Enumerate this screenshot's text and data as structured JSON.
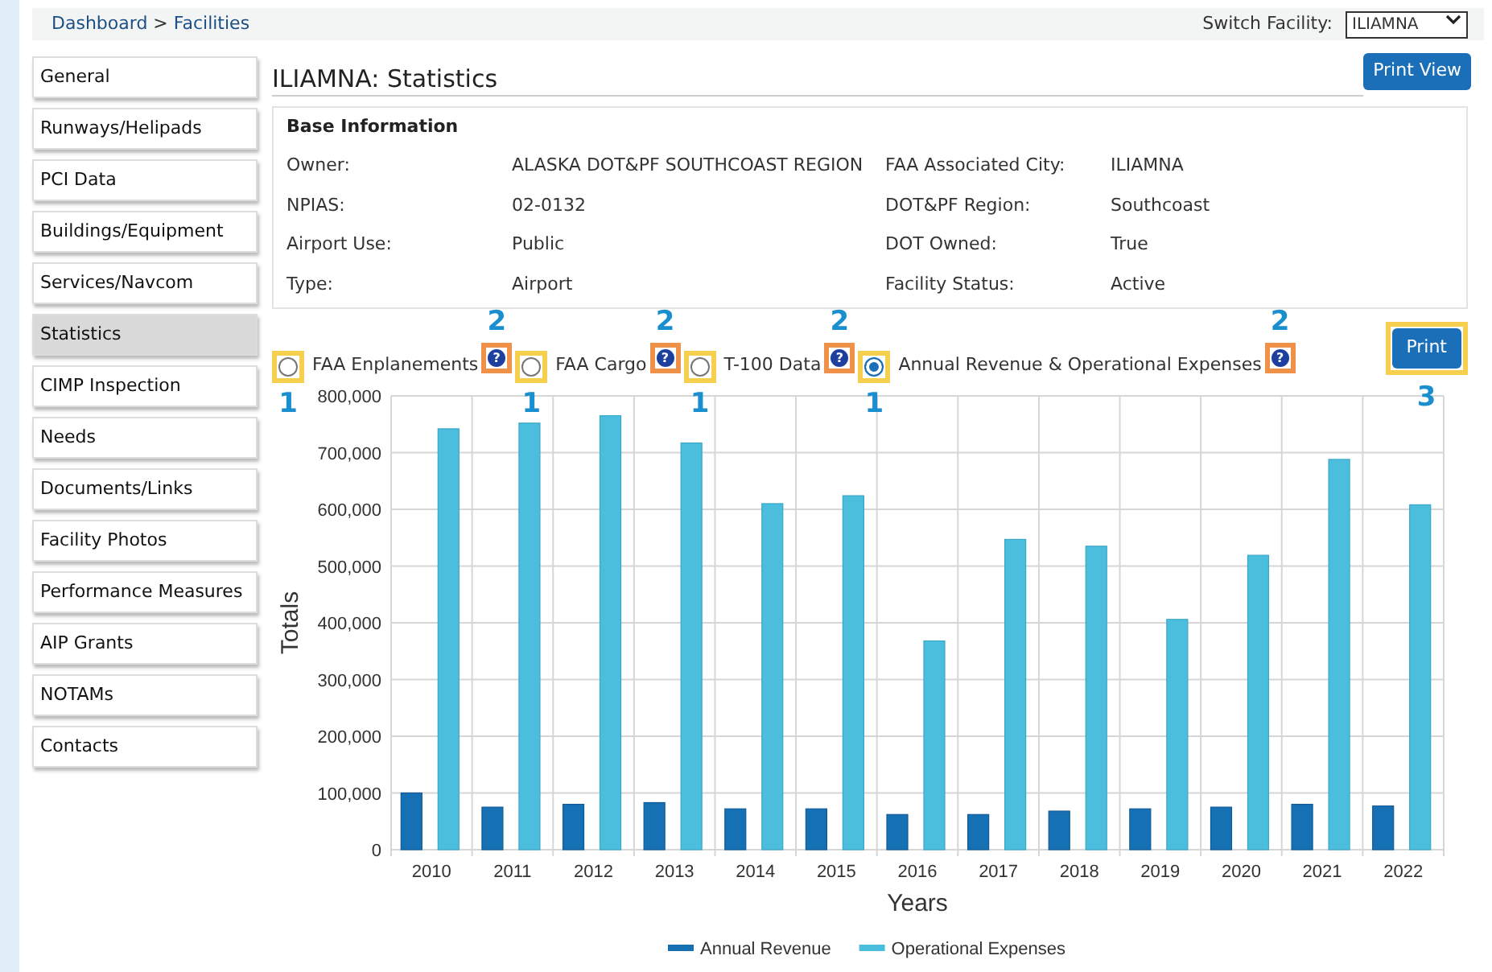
{
  "breadcrumb": {
    "items": [
      "Dashboard",
      "Facilities"
    ],
    "separator": ">"
  },
  "switch_facility": {
    "label": "Switch Facility:",
    "value": "ILIAMNA"
  },
  "sidebar": {
    "items": [
      {
        "label": "General",
        "selected": false
      },
      {
        "label": "Runways/Helipads",
        "selected": false
      },
      {
        "label": "PCI Data",
        "selected": false
      },
      {
        "label": "Buildings/Equipment",
        "selected": false
      },
      {
        "label": "Services/Navcom",
        "selected": false
      },
      {
        "label": "Statistics",
        "selected": true
      },
      {
        "label": "CIMP Inspection",
        "selected": false
      },
      {
        "label": "Needs",
        "selected": false
      },
      {
        "label": "Documents/Links",
        "selected": false
      },
      {
        "label": "Facility Photos",
        "selected": false
      },
      {
        "label": "Performance Measures",
        "selected": false
      },
      {
        "label": "AIP Grants",
        "selected": false
      },
      {
        "label": "NOTAMs",
        "selected": false
      },
      {
        "label": "Contacts",
        "selected": false
      }
    ]
  },
  "page_title": "ILIAMNA: Statistics",
  "print_view_button": "Print View",
  "base_information": {
    "title": "Base Information",
    "fields": [
      {
        "label": "Owner:",
        "value": "ALASKA DOT&PF SOUTHCOAST REGION"
      },
      {
        "label": "FAA Associated City:",
        "value": "ILIAMNA"
      },
      {
        "label": "NPIAS:",
        "value": "02-0132"
      },
      {
        "label": "DOT&PF Region:",
        "value": "Southcoast"
      },
      {
        "label": "Airport Use:",
        "value": "Public"
      },
      {
        "label": "DOT Owned:",
        "value": "True"
      },
      {
        "label": "Type:",
        "value": "Airport"
      },
      {
        "label": "Facility Status:",
        "value": "Active"
      }
    ]
  },
  "data_options": [
    {
      "label": "FAA Enplanements",
      "selected": false,
      "help_icon": "?",
      "radio_callout": "1",
      "help_callout": "2"
    },
    {
      "label": "FAA Cargo",
      "selected": false,
      "help_icon": "?",
      "radio_callout": "1",
      "help_callout": "2"
    },
    {
      "label": "T-100 Data",
      "selected": false,
      "help_icon": "?",
      "radio_callout": "1",
      "help_callout": "2"
    },
    {
      "label": "Annual Revenue & Operational Expenses",
      "selected": true,
      "help_icon": "?",
      "radio_callout": "1",
      "help_callout": "2"
    }
  ],
  "print_button": {
    "label": "Print",
    "callout": "3"
  },
  "chart_data": {
    "type": "bar",
    "xlabel": "Years",
    "ylabel": "Totals",
    "categories": [
      "2010",
      "2011",
      "2012",
      "2013",
      "2014",
      "2015",
      "2016",
      "2017",
      "2018",
      "2019",
      "2020",
      "2021",
      "2022"
    ],
    "series": [
      {
        "name": "Annual Revenue",
        "color": "#1670b4",
        "values": [
          100000,
          75000,
          80000,
          83000,
          72000,
          72000,
          62000,
          62000,
          68000,
          72000,
          75000,
          80000,
          77000
        ]
      },
      {
        "name": "Operational Expenses",
        "color": "#4bbede",
        "values": [
          742000,
          752000,
          765000,
          717000,
          610000,
          624000,
          368000,
          547000,
          535000,
          406000,
          519000,
          688000,
          608000
        ]
      }
    ],
    "ylim": [
      0,
      800000
    ],
    "grid": true,
    "legend": true,
    "yticks": [
      {
        "value": 0,
        "label": "0"
      },
      {
        "value": 100000,
        "label": "100,000"
      },
      {
        "value": 200000,
        "label": "200,000"
      },
      {
        "value": 300000,
        "label": "300,000"
      },
      {
        "value": 400000,
        "label": "400,000"
      },
      {
        "value": 500000,
        "label": "500,000"
      },
      {
        "value": 600000,
        "label": "600,000"
      },
      {
        "value": 700000,
        "label": "700,000"
      },
      {
        "value": 800000,
        "label": "800,000"
      }
    ]
  }
}
